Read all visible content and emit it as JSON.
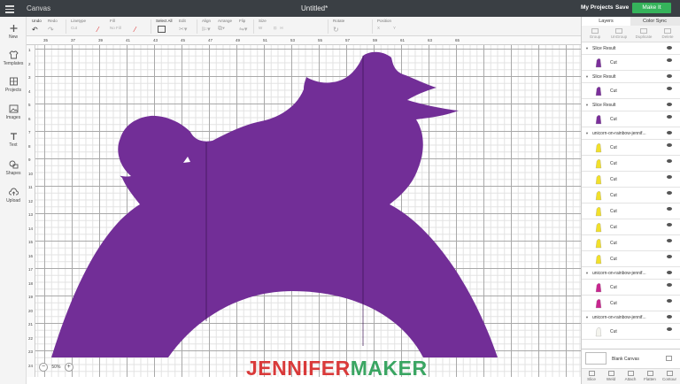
{
  "app": {
    "brand": "Canvas",
    "doc_title": "Untitled*",
    "my_projects": "My Projects",
    "save": "Save",
    "make": "Make It"
  },
  "toolbar": {
    "undo": "Undo",
    "redo": "Redo",
    "linetype": "Linetype",
    "linetype_value": "Cut",
    "fill": "Fill",
    "fill_value": "No Fill",
    "select_all": "Select All",
    "edit": "Edit",
    "align": "Align",
    "arrange": "Arrange",
    "flip": "Flip",
    "size": "Size",
    "size_w": "W",
    "size_h": "H",
    "rotate": "Rotate",
    "position": "Position",
    "pos_x": "X",
    "pos_y": "Y"
  },
  "sidebar": {
    "items": [
      {
        "label": "New",
        "icon": "plus-icon"
      },
      {
        "label": "Templates",
        "icon": "shirt-icon"
      },
      {
        "label": "Projects",
        "icon": "grid-icon"
      },
      {
        "label": "Images",
        "icon": "image-icon"
      },
      {
        "label": "Text",
        "icon": "text-icon"
      },
      {
        "label": "Shapes",
        "icon": "shapes-icon"
      },
      {
        "label": "Upload",
        "icon": "cloud-upload-icon"
      }
    ]
  },
  "ruler": {
    "top": [
      "35",
      "37",
      "39",
      "41",
      "43",
      "45",
      "47",
      "49",
      "51",
      "53",
      "55",
      "57",
      "59",
      "61",
      "63",
      "65"
    ],
    "left": [
      "1",
      "2",
      "3",
      "4",
      "5",
      "6",
      "7",
      "8",
      "9",
      "10",
      "11",
      "12",
      "13",
      "14",
      "15",
      "16",
      "17",
      "18",
      "19",
      "20",
      "21",
      "22",
      "23",
      "24"
    ]
  },
  "zoom": {
    "minus": "−",
    "value": "50%",
    "plus": "+"
  },
  "watermark": {
    "part1": "JENNIFER",
    "part2": "MAKER"
  },
  "panel": {
    "tabs": [
      "Layers",
      "Color Sync"
    ],
    "tools": [
      "Group",
      "UnGroup",
      "Duplicate",
      "Delete"
    ],
    "groups": [
      {
        "name": "Slice Result",
        "items": [
          {
            "type": "Cut",
            "color": "#7b2f9b"
          }
        ]
      },
      {
        "name": "Slice Result",
        "items": [
          {
            "type": "Cut",
            "color": "#7b2f9b"
          }
        ]
      },
      {
        "name": "Slice Result",
        "items": [
          {
            "type": "Cut",
            "color": "#7b2f9b"
          }
        ]
      },
      {
        "name": "unicorn-on-rainbow-jennif...",
        "items": [
          {
            "type": "Cut",
            "color": "#f2e02a"
          },
          {
            "type": "Cut",
            "color": "#f2e02a"
          },
          {
            "type": "Cut",
            "color": "#f2e02a"
          },
          {
            "type": "Cut",
            "color": "#f2e02a"
          },
          {
            "type": "Cut",
            "color": "#f2e02a"
          },
          {
            "type": "Cut",
            "color": "#f2e02a"
          },
          {
            "type": "Cut",
            "color": "#f2e02a"
          },
          {
            "type": "Cut",
            "color": "#f2e02a"
          }
        ]
      },
      {
        "name": "unicorn-on-rainbow-jennif...",
        "items": [
          {
            "type": "Cut",
            "color": "#c8268f"
          },
          {
            "type": "Cut",
            "color": "#c8268f"
          }
        ]
      },
      {
        "name": "unicorn-on-rainbow-jennif...",
        "items": [
          {
            "type": "Cut",
            "color": "#f4f4ee"
          }
        ]
      }
    ],
    "blank_canvas": "Blank Canvas",
    "bottom_tools": [
      "Slice",
      "Weld",
      "Attach",
      "Flatten",
      "Contour"
    ]
  },
  "colors": {
    "shape": "#722e97",
    "topbar": "#3a3f44",
    "make_button": "#35b35b"
  }
}
